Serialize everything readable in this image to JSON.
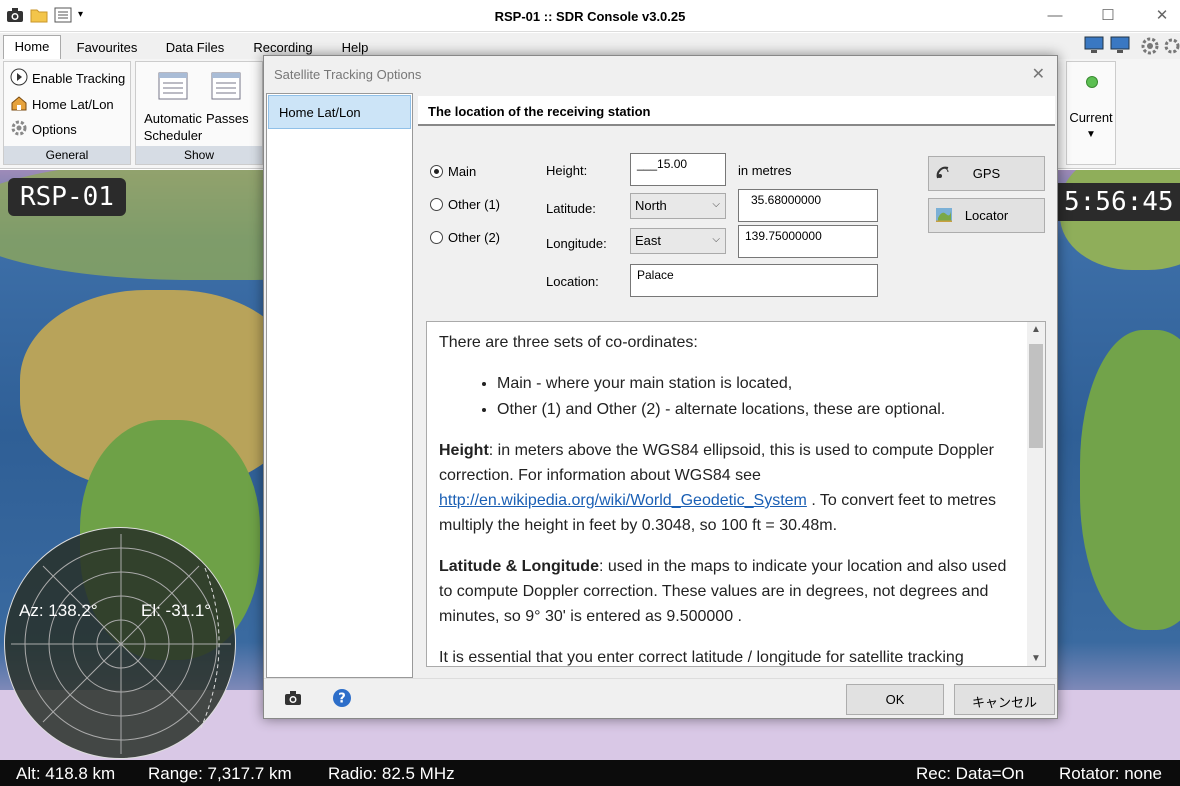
{
  "app": {
    "title": "RSP-01 :: SDR Console v3.0.25"
  },
  "window_controls": {
    "minimize": "—",
    "maximize": "☐",
    "close": "✕"
  },
  "menu": {
    "tabs": [
      "Home",
      "Favourites",
      "Data Files",
      "Recording",
      "Help"
    ],
    "active": "Home"
  },
  "ribbon": {
    "general": {
      "enable_tracking": "Enable Tracking",
      "home_lat_lon": "Home Lat/Lon",
      "options": "Options",
      "label": "General"
    },
    "show": {
      "automatic": "Automatic",
      "scheduler": "Scheduler",
      "passes": "Passes",
      "label": "Show"
    },
    "current": {
      "label": "Current"
    }
  },
  "map": {
    "station_badge": "RSP-01",
    "clock_badge": "5:56:45",
    "az": "Az: 138.2°",
    "el": "El: -31.1°"
  },
  "status": {
    "alt": "Alt: 418.8 km",
    "range": "Range: 7,317.7 km",
    "radio": "Radio: 82.5 MHz",
    "rec": "Rec: Data=On",
    "rotator": "Rotator: none"
  },
  "dialog": {
    "title": "Satellite Tracking Options",
    "nav_item": "Home Lat/Lon",
    "header": "The location of the receiving station",
    "radios": {
      "main": "Main",
      "other1": "Other (1)",
      "other2": "Other (2)",
      "selected": "Main"
    },
    "height": {
      "label": "Height:",
      "value": "___15.00",
      "unit": "in metres"
    },
    "latitude": {
      "label": "Latitude:",
      "hemisphere": "North",
      "value": "35.68000000"
    },
    "longitude": {
      "label": "Longitude:",
      "hemisphere": "East",
      "value": "139.75000000"
    },
    "location": {
      "label": "Location:",
      "value": "Palace"
    },
    "buttons": {
      "gps": "GPS",
      "locator": "Locator",
      "ok": "OK",
      "cancel": "キャンセル"
    },
    "help": {
      "intro": "There are three sets of co-ordinates:",
      "bullets": [
        "Main - where your main station is located,",
        "Other (1) and Other (2) - alternate locations, these are optional."
      ],
      "height_term": "Height",
      "height_text": ": in meters above the WGS84 ellipsoid, this is used to compute Doppler correction. For information about WGS84 see ",
      "height_link": "http://en.wikipedia.org/wiki/World_Geodetic_System",
      "height_text2": " . To convert feet to metres multiply the height in feet by 0.3048, so 100 ft = 30.48m.",
      "latlon_term": "Latitude & Longitude",
      "latlon_text": ": used in the maps to indicate your location and also used to compute Doppler correction. These values are in degrees, not degrees and minutes, so 9° 30' is entered as 9.500000 .",
      "cutoff": "It is essential that you enter correct latitude / longitude for satellite tracking"
    }
  }
}
